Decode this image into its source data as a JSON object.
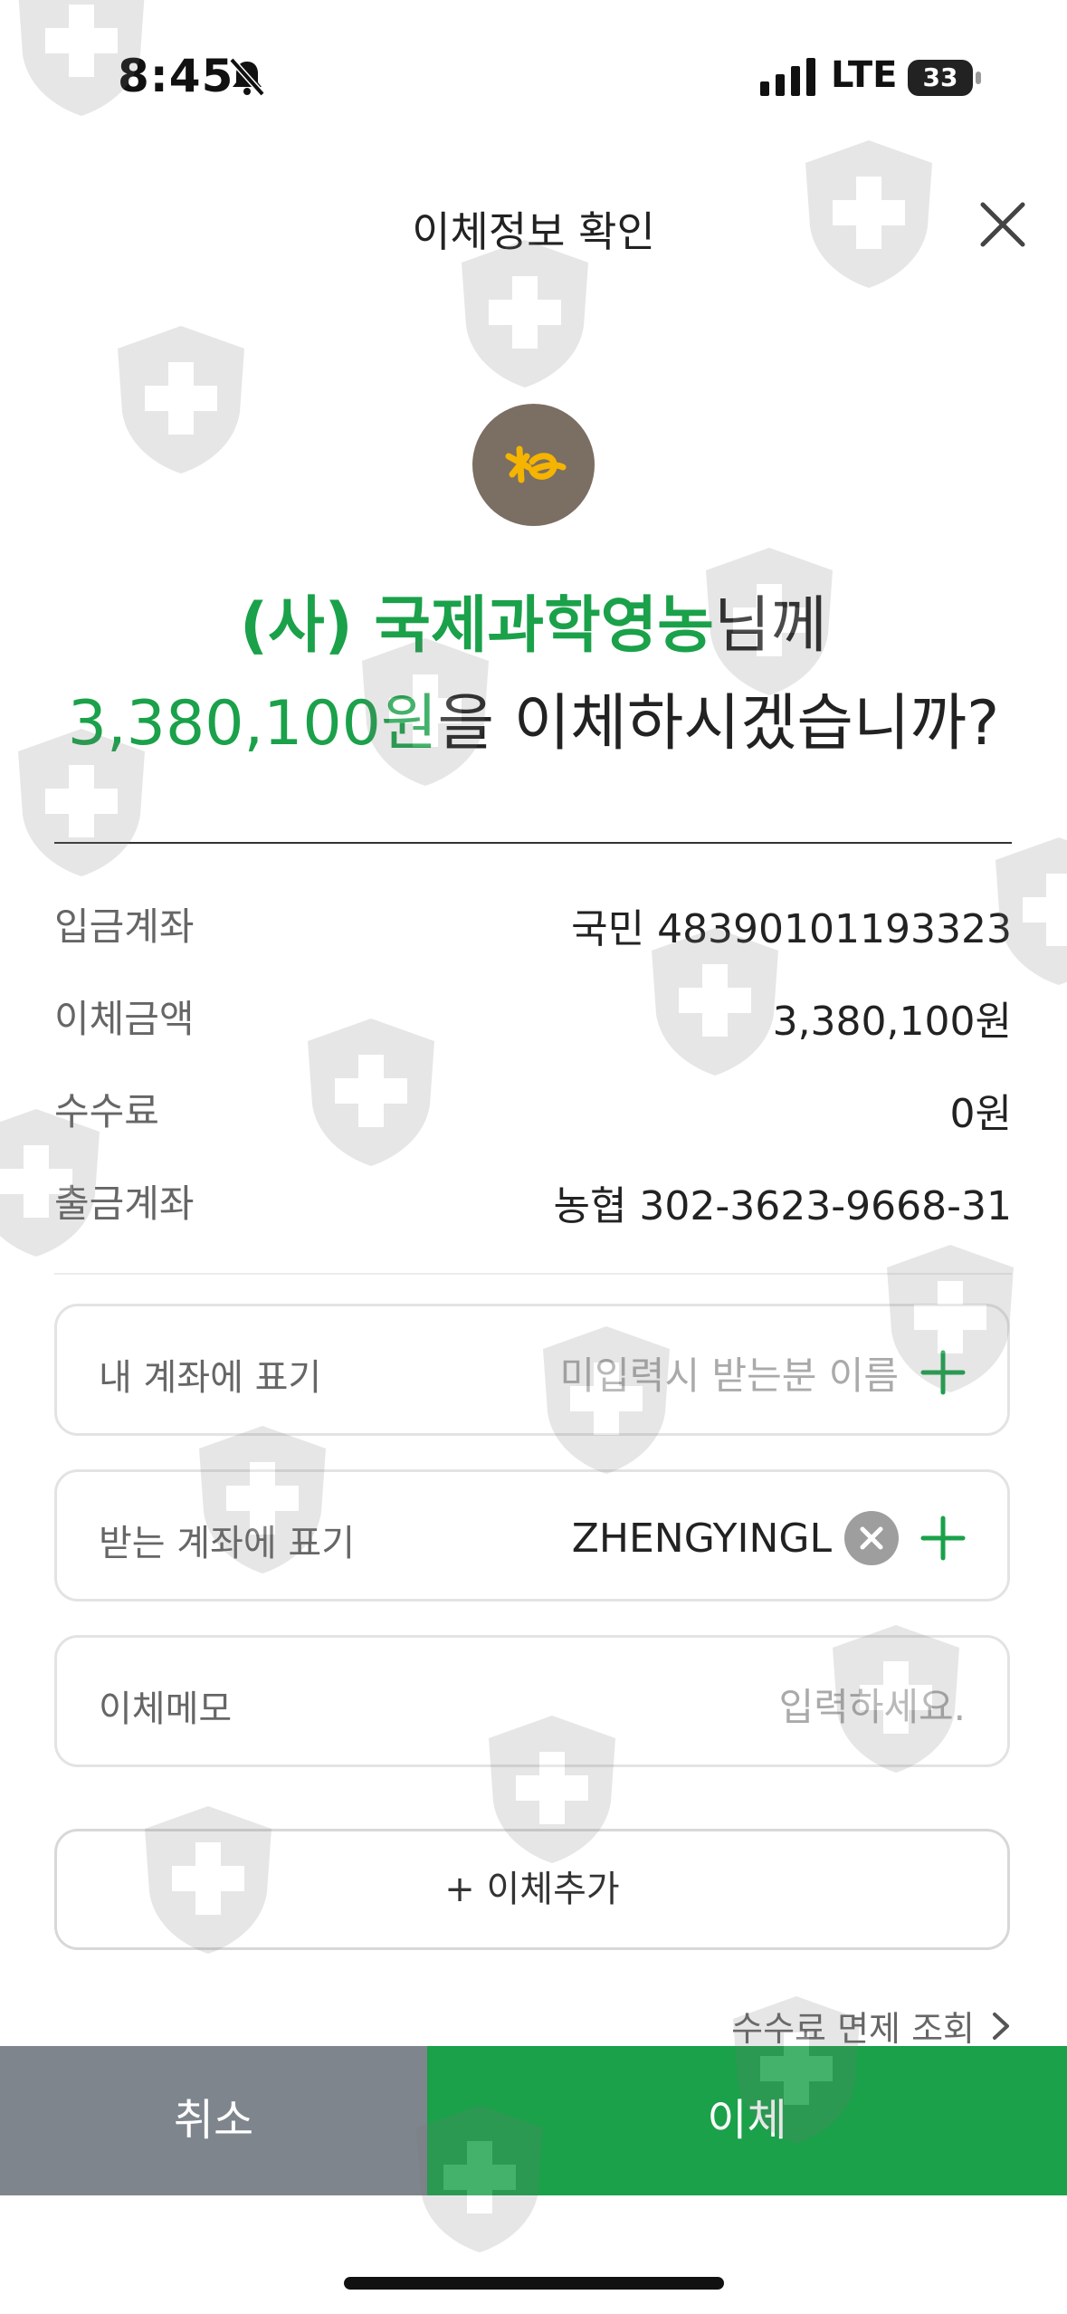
{
  "status_bar": {
    "time": "8:45",
    "network": "LTE",
    "battery": "33"
  },
  "header": {
    "title": "이체정보 확인"
  },
  "headline": {
    "recipient_name": "(사) 국제과학영농",
    "recipient_suffix": "님께",
    "amount": "3,380,100원",
    "question": "을 이체하시겠습니까?"
  },
  "details": [
    {
      "label": "입금계좌",
      "value": "국민 48390101193323"
    },
    {
      "label": "이체금액",
      "value": "3,380,100원"
    },
    {
      "label": "수수료",
      "value": "0원"
    },
    {
      "label": "출금계좌",
      "value": "농협 302-3623-9668-31"
    }
  ],
  "fields": {
    "my_account_memo": {
      "label": "내 계좌에 표기",
      "placeholder": "미입력시 받는분 이름"
    },
    "recipient_memo": {
      "label": "받는 계좌에 표기",
      "value": "ZHENGYINGL"
    },
    "transfer_memo": {
      "label": "이체메모",
      "placeholder": "입력하세요."
    }
  },
  "add_transfer_label": "+ 이체추가",
  "fee_exemption_link": "수수료 면제 조회",
  "buttons": {
    "cancel": "취소",
    "transfer": "이체"
  },
  "colors": {
    "accent_green": "#1aa14a",
    "cancel_gray": "#7e858d",
    "bank_logo_bg": "#7b6e63",
    "bank_logo_mark": "#f4b400"
  }
}
